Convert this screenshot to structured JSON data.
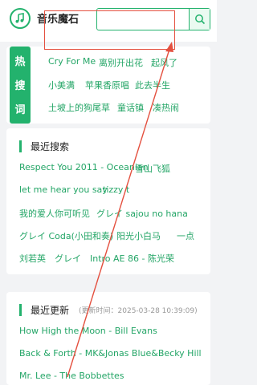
{
  "header": {
    "title": "音乐魔石",
    "search_placeholder": "",
    "search_value": ""
  },
  "hot_search": {
    "side_chars": [
      "热",
      "搜",
      "词"
    ],
    "tags": [
      "Cry For Me",
      "离别开出花",
      "起风了",
      "小美满",
      "苹果香原唱",
      "此去半生",
      "土坡上的狗尾草",
      "童话镇",
      "凑热闹"
    ]
  },
  "recent_search": {
    "title": "最近搜索",
    "items": [
      "Respect You 2011 - Oceanian",
      "雪山飞狐",
      "let me hear you say",
      "tizzy t",
      "我的爱人你可听见",
      "グレイ sajou no hana",
      "グレイ Coda(小田和奏)",
      "阳光小白马",
      "一点",
      "刘若英",
      "グレイ",
      "Intro AE 86 - 陈光荣"
    ]
  },
  "recent_update": {
    "title": "最近更新",
    "subtitle": "(更新时间：2025-03-28 10:39:09)",
    "items": [
      "How High the Moon - Bill Evans",
      "Back & Forth - MK&Jonas Blue&Becky Hill",
      "Mr. Lee - The Bobbettes"
    ]
  },
  "colors": {
    "accent": "#23b26d",
    "annotation": "#e4503f"
  },
  "icons": {
    "logo": "music-note-icon",
    "search": "search-icon"
  }
}
